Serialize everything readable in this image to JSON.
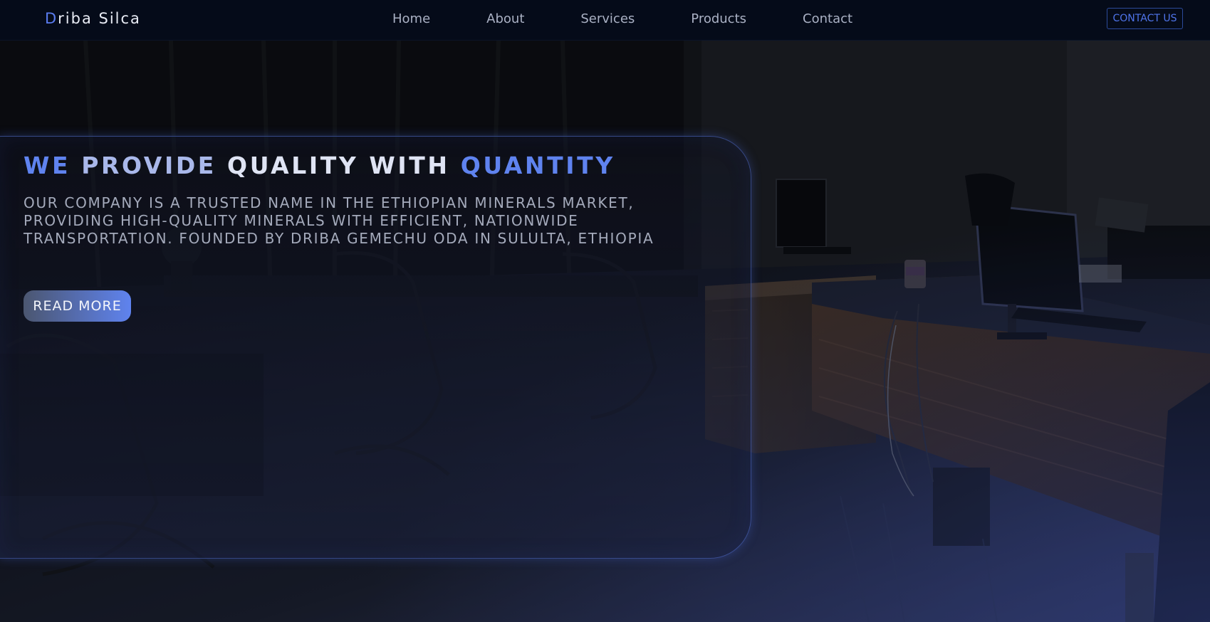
{
  "brand": {
    "logo_first_letter": "D",
    "logo_rest": "riba Silca",
    "accent_color": "#5f83ef"
  },
  "nav": {
    "items": [
      {
        "label": "Home"
      },
      {
        "label": "About"
      },
      {
        "label": "Services"
      },
      {
        "label": "Products"
      },
      {
        "label": "Contact"
      }
    ],
    "contact_button": "CONTACT US"
  },
  "hero": {
    "headline_parts": [
      "WE ",
      "PROVIDE ",
      "QUALITY WITH ",
      "QUANTITY"
    ],
    "description": "OUR COMPANY IS A TRUSTED NAME IN THE ETHIOPIAN MINERALS MARKET, PROVIDING HIGH-QUALITY MINERALS WITH EFFICIENT, NATIONWIDE TRANSPORTATION. FOUNDED BY DRIBA GEMECHU ODA IN SULULTA, ETHIOPIA",
    "read_more_label": "READ MORE",
    "background_image": "office-interior-photo"
  }
}
